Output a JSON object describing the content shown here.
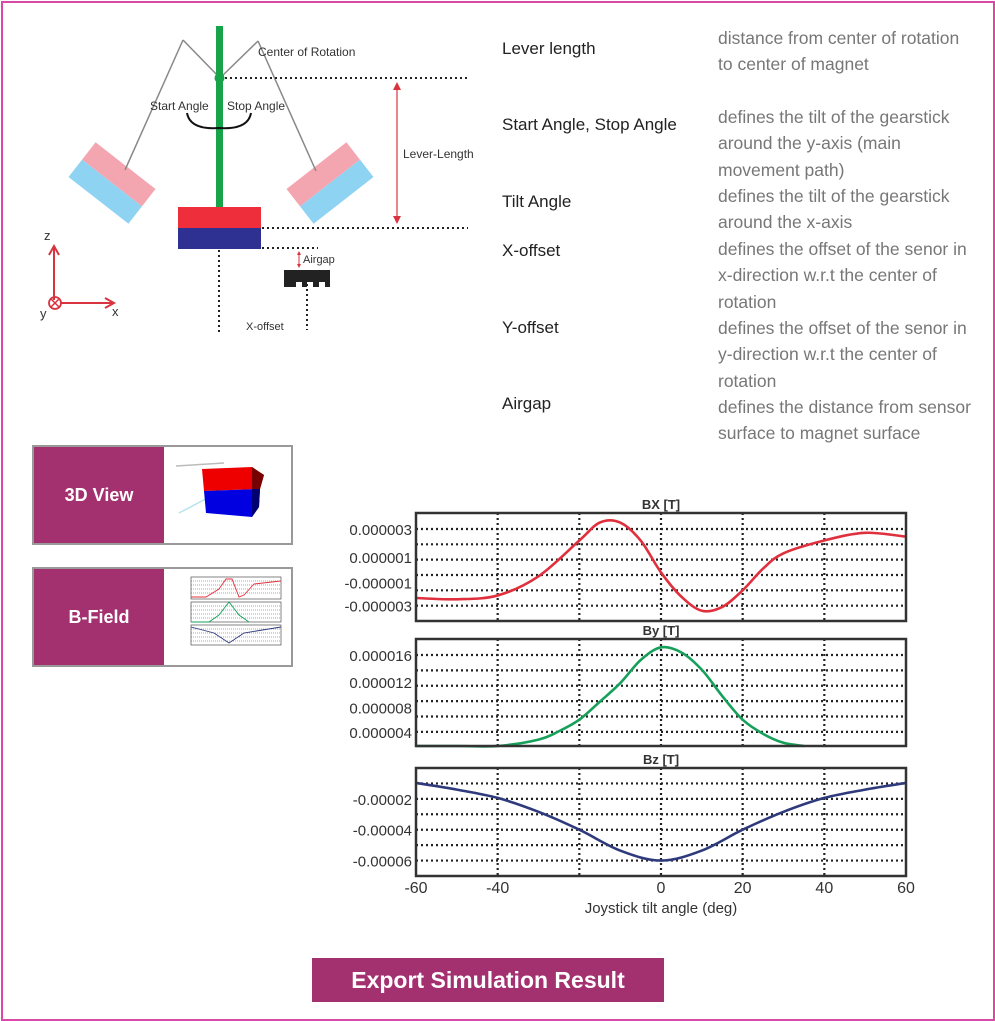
{
  "diagram": {
    "labels": {
      "center_of_rotation": "Center of Rotation",
      "start_angle": "Start Angle",
      "stop_angle": "Stop Angle",
      "lever_length": "Lever-Length",
      "airgap": "Airgap",
      "x_offset": "X-offset",
      "axis_z": "z",
      "axis_x": "x",
      "axis_y": "y"
    },
    "colors": {
      "lever": "#16a34a",
      "magnet_north": "#ee2e3b",
      "magnet_south": "#2e3191",
      "ghost_north": "#f4a6b0",
      "ghost_south": "#8fd3f3",
      "annotation": "#d9333f"
    }
  },
  "parameters": [
    {
      "name": "Lever length",
      "description": "distance from center of rotation to center of magnet"
    },
    {
      "name": "Start Angle, Stop Angle",
      "description": "defines the tilt of the gearstick around the y-axis (main movement path)"
    },
    {
      "name": "Tilt Angle",
      "description": "defines the tilt of the gearstick around the x-axis"
    },
    {
      "name": "X-offset",
      "description": "defines the offset of the senor in x-direction w.r.t the center of rotation"
    },
    {
      "name": "Y-offset",
      "description": "defines the offset of the senor in y-direction w.r.t the center of rotation"
    },
    {
      "name": "Airgap",
      "description": "defines the distance from sensor surface to magnet surface"
    }
  ],
  "nav": {
    "view3d_label": "3D View",
    "bfield_label": "B-Field"
  },
  "export_label": "Export Simulation Result",
  "theme": {
    "accent": "#a3306f",
    "frame_border": "#d94aa6"
  },
  "chart_data": [
    {
      "type": "line",
      "title": "BX [T]",
      "color": "#e0303e",
      "xlim": [
        -60,
        60
      ],
      "ylim": [
        -4.2e-06,
        4.25e-06
      ],
      "xticks": [
        -60,
        -40,
        -20,
        0,
        20,
        40,
        60
      ],
      "ygrid": [
        3e-06,
        1.8e-06,
        6e-07,
        -6e-07,
        -1.8e-06,
        -3e-06
      ],
      "ytick_labels": [
        {
          "value": 3e-06,
          "label": "0.000003"
        },
        {
          "value": 8e-07,
          "label": "0.000001"
        },
        {
          "value": -1.2e-06,
          "label": "-0.000001"
        },
        {
          "value": -3e-06,
          "label": "-0.000003"
        }
      ],
      "grid": true,
      "x": [
        -60,
        -50,
        -40,
        -30,
        -20,
        -15,
        -10,
        -5,
        0,
        5,
        10,
        15,
        20,
        25,
        30,
        40,
        50,
        60
      ],
      "y": [
        -2.4e-06,
        -2.5e-06,
        -2.2e-06,
        -7e-07,
        2.1e-06,
        3.5e-06,
        3.5e-06,
        2.1e-06,
        -4e-07,
        -2.3e-06,
        -3.4e-06,
        -3.1e-06,
        -1.8e-06,
        -1e-07,
        1.1e-06,
        2.1e-06,
        2.7e-06,
        2.4e-06
      ]
    },
    {
      "type": "line",
      "title": "By [T]",
      "color": "#16a05a",
      "xlim": [
        -60,
        60
      ],
      "ylim": [
        1.8e-06,
        1.85e-05
      ],
      "xticks": [
        -60,
        -40,
        -20,
        0,
        20,
        40,
        60
      ],
      "ygrid": [
        1.6e-05,
        1.36e-05,
        1.12e-05,
        8.8e-06,
        6.4e-06,
        4e-06
      ],
      "ytick_labels": [
        {
          "value": 1.6e-05,
          "label": "0.000016"
        },
        {
          "value": 1.18e-05,
          "label": "0.000012"
        },
        {
          "value": 7.8e-06,
          "label": "0.000008"
        },
        {
          "value": 4e-06,
          "label": "0.000004"
        }
      ],
      "grid": true,
      "x": [
        -60,
        -50,
        -40,
        -30,
        -25,
        -20,
        -15,
        -10,
        -5,
        0,
        5,
        10,
        15,
        20,
        25,
        30,
        35
      ],
      "y": [
        1.8e-06,
        1.8e-06,
        1.8e-06,
        2.8e-06,
        4.1e-06,
        5.9e-06,
        8.7e-06,
        1.16e-05,
        1.52e-05,
        1.72e-05,
        1.64e-05,
        1.37e-05,
        9.6e-06,
        5.9e-06,
        3.7e-06,
        2.3e-06,
        1.8e-06
      ]
    },
    {
      "type": "line",
      "title": "Bz [T]",
      "color": "#2e3a7c",
      "xlim": [
        -60,
        60
      ],
      "ylim": [
        -7e-05,
        0
      ],
      "xticks": [
        -60,
        -40,
        -20,
        0,
        20,
        40,
        60
      ],
      "xtick_labels": [
        "-60",
        "-40",
        "",
        "0",
        "20",
        "40",
        "60"
      ],
      "xlabel": "Joystick tilt angle (deg)",
      "ygrid": [
        -1e-05,
        -2e-05,
        -3e-05,
        -4e-05,
        -5e-05,
        -6e-05
      ],
      "ytick_labels": [
        {
          "value": -2e-05,
          "label": "-0.00002"
        },
        {
          "value": -4e-05,
          "label": "-0.00004"
        },
        {
          "value": -6e-05,
          "label": "-0.00006"
        }
      ],
      "grid": true,
      "x": [
        -60,
        -50,
        -40,
        -30,
        -20,
        -10,
        0,
        10,
        20,
        30,
        40,
        50,
        60
      ],
      "y": [
        -9.7e-06,
        -1.4e-05,
        -1.94e-05,
        -2.84e-05,
        -4e-05,
        -5.35e-05,
        -6e-05,
        -5.35e-05,
        -4e-05,
        -2.84e-05,
        -1.94e-05,
        -1.4e-05,
        -9.7e-06
      ]
    }
  ]
}
